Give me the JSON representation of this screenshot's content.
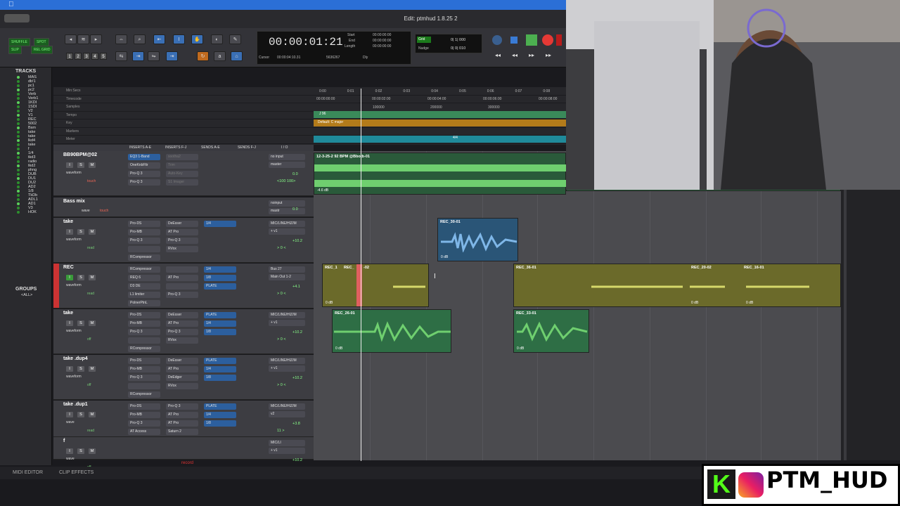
{
  "app": {
    "window_title": "Edit: ptmhud 1.8.25 2",
    "apple_icon": "apple-icon"
  },
  "toolbar": {
    "modes": [
      "SHUFFLE",
      "SPOT",
      "SLIP",
      "REL GRID"
    ],
    "numbers": [
      "1",
      "2",
      "3",
      "4",
      "5"
    ],
    "counter_main": "00:00:01:21",
    "start_label": "Start",
    "end_label": "End",
    "length_label": "Length",
    "start": "00:00:00:00",
    "end": "00:00:00:00",
    "length": "00:00:00:00",
    "cursor_label": "Cursor",
    "cursor_value": "00:00:04:10.31",
    "cursor_samples": "5636267",
    "dly_label": "Dly",
    "grid_label": "Grid",
    "grid_value": "0| 1| 000",
    "nudge_label": "Nudge",
    "nudge_value": "0| 0| 010"
  },
  "tracks_panel": {
    "title": "TRACKS",
    "items": [
      "MAS",
      "db!1",
      "pc1",
      "pc2",
      "Verb",
      "Verb1",
      "1KDI",
      "1SDI",
      "V2",
      "V1",
      "REC",
      "5002",
      "Bsm",
      "take",
      "take",
      "lkd4",
      "take",
      "f",
      "1/4",
      "tkd3",
      "radio",
      "tkd2",
      "phng",
      "DUB",
      "DU1",
      "DU2",
      "AD2",
      "1/8",
      "TkDb",
      "ADL1",
      "AD1",
      "V3",
      "HOK"
    ]
  },
  "groups_panel": {
    "title": "GROUPS",
    "all": "<ALL>"
  },
  "rulers": {
    "rows": [
      "Min:Secs",
      "Timecode",
      "Samples",
      "Tempo",
      "Key",
      "Markers",
      "Meter"
    ],
    "min_ticks": [
      "0:00",
      "0:01",
      "0:02",
      "0:03",
      "0:04",
      "0:05",
      "0:06",
      "0:07",
      "0:08"
    ],
    "tc_ticks": [
      "00:00:00:00",
      "00:00:02:00",
      "00:00:04:00",
      "00:00:06:00",
      "00:00:08:00"
    ],
    "sample_ticks": [
      "100000",
      "200000",
      "300000"
    ],
    "tempo": "J 96",
    "key": "Default: C major",
    "meter": "4/4"
  },
  "column_headers": [
    "INSERTS A-E",
    "INSERTS F-J",
    "SENDS A-E",
    "SENDS F-J",
    "I / O"
  ],
  "tracks": [
    {
      "name": "BB90BPM@02",
      "ins": [
        "EQ3 1-Band",
        "OneKnbFltr",
        "Pro-Q 3",
        "Pro-Q 3"
      ],
      "ins2": [
        "sootha2",
        "Trim",
        "Auto-Key",
        "S1 Imager"
      ],
      "io": [
        "no input",
        "master"
      ],
      "vol": "0.0",
      "pan": "<100  100>",
      "view": "waveform",
      "auto": "touch",
      "clip": "12-3-25-2 92 BPM @Bbotb-01",
      "clipdb": "-4.6 dB"
    },
    {
      "name": "Bass mix",
      "view": "wave",
      "auto": "touch",
      "io": [
        "noinput",
        "mastr"
      ],
      "vol": "0.0"
    },
    {
      "name": "take",
      "ins": [
        "Pro-DS",
        "Pro-MB",
        "Pro-Q 3",
        "",
        "RCompressor"
      ],
      "ins2": [
        "DeEsser",
        "AT Pro",
        "Pro-Q 3",
        "RVox"
      ],
      "sends": [
        "1/4"
      ],
      "io": [
        "MIC/LINE/HIZ/M",
        "+ v1"
      ],
      "vol": "+10.2",
      "pan": "> 0 <",
      "view": "waveform",
      "auto": "read"
    },
    {
      "name": "REC",
      "ins": [
        "RCompressor",
        "REQ 6",
        "D3 DE",
        "L1 limiter",
        "PolnerPtnL"
      ],
      "ins2": [
        "",
        "AT Pro",
        "",
        "Pro-Q 3"
      ],
      "sends": [
        "1/4",
        "1/8",
        "PLATE"
      ],
      "io": [
        "Bus 27",
        "Main Out 1-2"
      ],
      "vol": "+4.1",
      "pan": "> 0 <",
      "view": "waveform",
      "auto": "read"
    },
    {
      "name": "take",
      "ins": [
        "Pro-DS",
        "Pro-MB",
        "Pro-Q 3",
        "",
        "RCompressor"
      ],
      "ins2": [
        "DeEsser",
        "AT Pro",
        "Pro-Q 3",
        "RVox"
      ],
      "sends": [
        "PLATE",
        "1/4",
        "1/8"
      ],
      "io": [
        "MIC/LINE/HIZ/M",
        "+ v1"
      ],
      "vol": "+10.2",
      "pan": "> 0 <",
      "view": "waveform",
      "auto": "off"
    },
    {
      "name": "take .dup4",
      "ins": [
        "Pro-DS",
        "Pro-MB",
        "Pro-Q 3",
        "",
        "RCompressor"
      ],
      "ins2": [
        "DeEsser",
        "AT Pro",
        "DeEdger",
        "RVox"
      ],
      "sends": [
        "PLATE",
        "1/4",
        "1/8"
      ],
      "io": [
        "MIC/LINE/HIZ/M",
        "+ v1"
      ],
      "vol": "+10.2",
      "pan": "> 0 <",
      "view": "waveform",
      "auto": "off"
    },
    {
      "name": "take .dup1",
      "ins": [
        "Pro-DS",
        "Pro-MB",
        "Pro-Q 3",
        "AT Access"
      ],
      "ins2": [
        "Pro-Q 3",
        "AT Pro",
        "AT Pro",
        "Saturn 2"
      ],
      "sends": [
        "PLATE",
        "1/4",
        "1/8"
      ],
      "io": [
        "MIC/LINE/HIZ/M",
        "v2"
      ],
      "vol": "+3.8",
      "pan": "11 >",
      "view": "wave",
      "auto": "read"
    },
    {
      "name": "f",
      "io": [
        "MIC/LI",
        "+ v1"
      ],
      "vol": "+10.2",
      "view": "wave",
      "auto": "off"
    }
  ],
  "clips": {
    "rec30": "REC_30-01",
    "rec1": "REC_1",
    "recb": "REC_",
    "rec02": "-02",
    "rec36": "REC_36-01",
    "rec2002": "REC_20-02",
    "rec16": "REC_16-01",
    "rec26": "REC_26-01",
    "rec33": "REC_33-01",
    "db": "0 dB"
  },
  "record_label": "record",
  "bottom": {
    "midi": "MIDI EDITOR",
    "clip_fx": "CLIP EFFECTS"
  },
  "overlay": {
    "handle": "PTM_HUD",
    "kick_letter": "K"
  },
  "colors": {
    "accent": "#2b6fd6",
    "green_clip": "#2e6e45",
    "yellow_clip": "#6b6a2a",
    "blue_clip": "#2a5577",
    "wave_green": "#6fcf6f",
    "wave_blue": "#7fb7e8",
    "wave_yellow": "#d6d86a"
  }
}
